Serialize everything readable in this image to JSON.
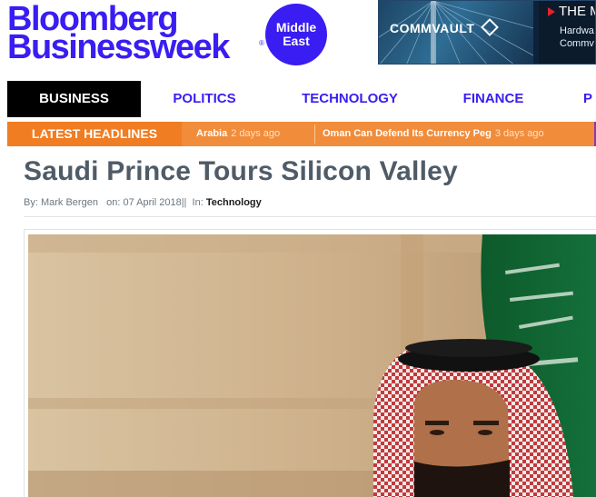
{
  "header": {
    "logo_line1": "Bloomberg",
    "logo_line2": "Businessweek",
    "logo_registered": "®",
    "region_line1": "Middle",
    "region_line2": "East"
  },
  "ad": {
    "brand": "COMMVAULT",
    "headline": "THE M",
    "line1": "Hardwa",
    "line2": "Commv"
  },
  "nav": {
    "items": [
      {
        "label": "BUSINESS",
        "active": true
      },
      {
        "label": "POLITICS"
      },
      {
        "label": "TECHNOLOGY"
      },
      {
        "label": "FINANCE"
      },
      {
        "label": "P"
      }
    ]
  },
  "ticker": {
    "label": "LATEST HEADLINES",
    "items": [
      {
        "title": "Arabia",
        "ago": "2 days ago"
      },
      {
        "title": "Oman Can Defend Its Currency Peg",
        "ago": "3 days ago"
      }
    ]
  },
  "article": {
    "title": "Saudi Prince Tours Silicon Valley",
    "by_label": "By:",
    "author": "Mark Bergen",
    "on_label": "on:",
    "date": "07 April 2018||",
    "in_label": "In:",
    "category": "Technology"
  },
  "colors": {
    "brand": "#3a1df2",
    "ticker_bg": "#f18c3b",
    "ticker_label_bg": "#f07d22",
    "title": "#4f5b66"
  }
}
